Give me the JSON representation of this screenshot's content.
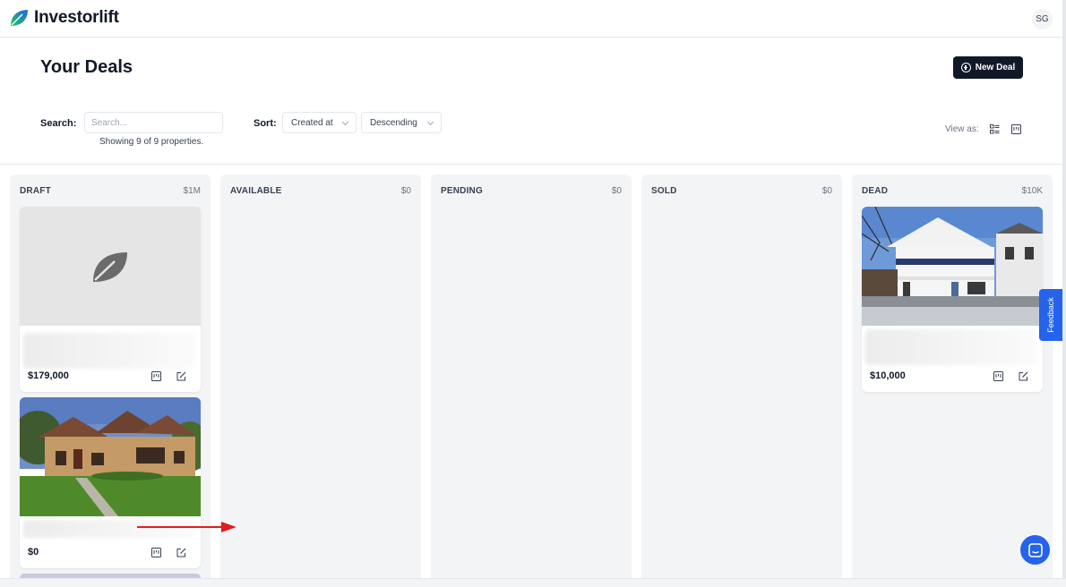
{
  "app": {
    "name": "Investorlift",
    "user_initials": "SG"
  },
  "page": {
    "title": "Your Deals",
    "new_deal_label": "New Deal"
  },
  "filters": {
    "search_label": "Search:",
    "search_placeholder": "Search...",
    "showing_text": "Showing 9 of 9 properties.",
    "sort_label": "Sort:",
    "sort_field": "Created at",
    "sort_order": "Descending",
    "view_as_label": "View as:"
  },
  "columns": [
    {
      "title": "DRAFT",
      "total": "$1M"
    },
    {
      "title": "AVAILABLE",
      "total": "$0"
    },
    {
      "title": "PENDING",
      "total": "$0"
    },
    {
      "title": "SOLD",
      "total": "$0"
    },
    {
      "title": "DEAD",
      "total": "$10K"
    }
  ],
  "cards": {
    "draft_1": {
      "price": "$179,000",
      "image": "placeholder-leaf"
    },
    "draft_2": {
      "price": "$0",
      "image": "stone-house-photo"
    },
    "dead_1": {
      "price": "$10,000",
      "image": "porch-house-photo"
    }
  },
  "widgets": {
    "feedback_label": "Feedback"
  },
  "colors": {
    "primary_dark": "#111827",
    "brand_blue": "#2563eb",
    "column_bg": "#f3f4f6",
    "annotation_red": "#e11d1d"
  }
}
